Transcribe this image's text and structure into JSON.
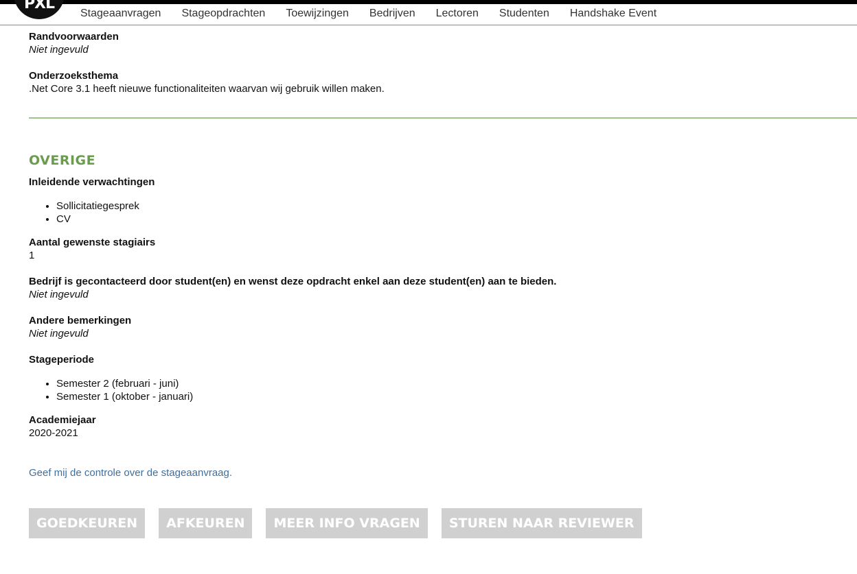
{
  "logo": {
    "text": "PXL"
  },
  "nav": {
    "items": [
      {
        "label": "Stageaanvragen"
      },
      {
        "label": "Stageopdrachten"
      },
      {
        "label": "Toewijzingen"
      },
      {
        "label": "Bedrijven"
      },
      {
        "label": "Lectoren"
      },
      {
        "label": "Studenten"
      },
      {
        "label": "Handshake Event"
      }
    ]
  },
  "fields": {
    "randvoorwaarden": {
      "label": "Randvoorwaarden",
      "value": "Niet ingevuld"
    },
    "onderzoeksthema": {
      "label": "Onderzoeksthema",
      "value": ".Net Core 3.1 heeft nieuwe functionaliteiten waarvan wij gebruik willen maken."
    }
  },
  "overige": {
    "title": "OVERIGE",
    "inleidende": {
      "label": "Inleidende verwachtingen",
      "items": [
        "Sollicitatiegesprek",
        "CV"
      ]
    },
    "aantal": {
      "label": "Aantal gewenste stagiairs",
      "value": "1"
    },
    "gecontacteerd": {
      "label": "Bedrijf is gecontacteerd door student(en) en wenst deze opdracht enkel aan deze student(en) aan te bieden.",
      "value": "Niet ingevuld"
    },
    "bemerkingen": {
      "label": "Andere bemerkingen",
      "value": "Niet ingevuld"
    },
    "stageperiode": {
      "label": "Stageperiode",
      "items": [
        "Semester 2 (februari - juni)",
        "Semester 1 (oktober - januari)"
      ]
    },
    "academiejaar": {
      "label": "Academiejaar",
      "value": "2020-2021"
    }
  },
  "control_link": "Geef mij de controle over de stageaanvraag.",
  "buttons": {
    "approve": "GOEDKEUREN",
    "reject": "AFKEUREN",
    "more_info": "MEER INFO VRAGEN",
    "send_reviewer": "STUREN NAAR REVIEWER"
  },
  "colors": {
    "accent_green": "#6a9c4f",
    "divider_green": "#9cc38a",
    "link_blue": "#3e6f9e",
    "button_disabled": "#d0d0d0"
  }
}
